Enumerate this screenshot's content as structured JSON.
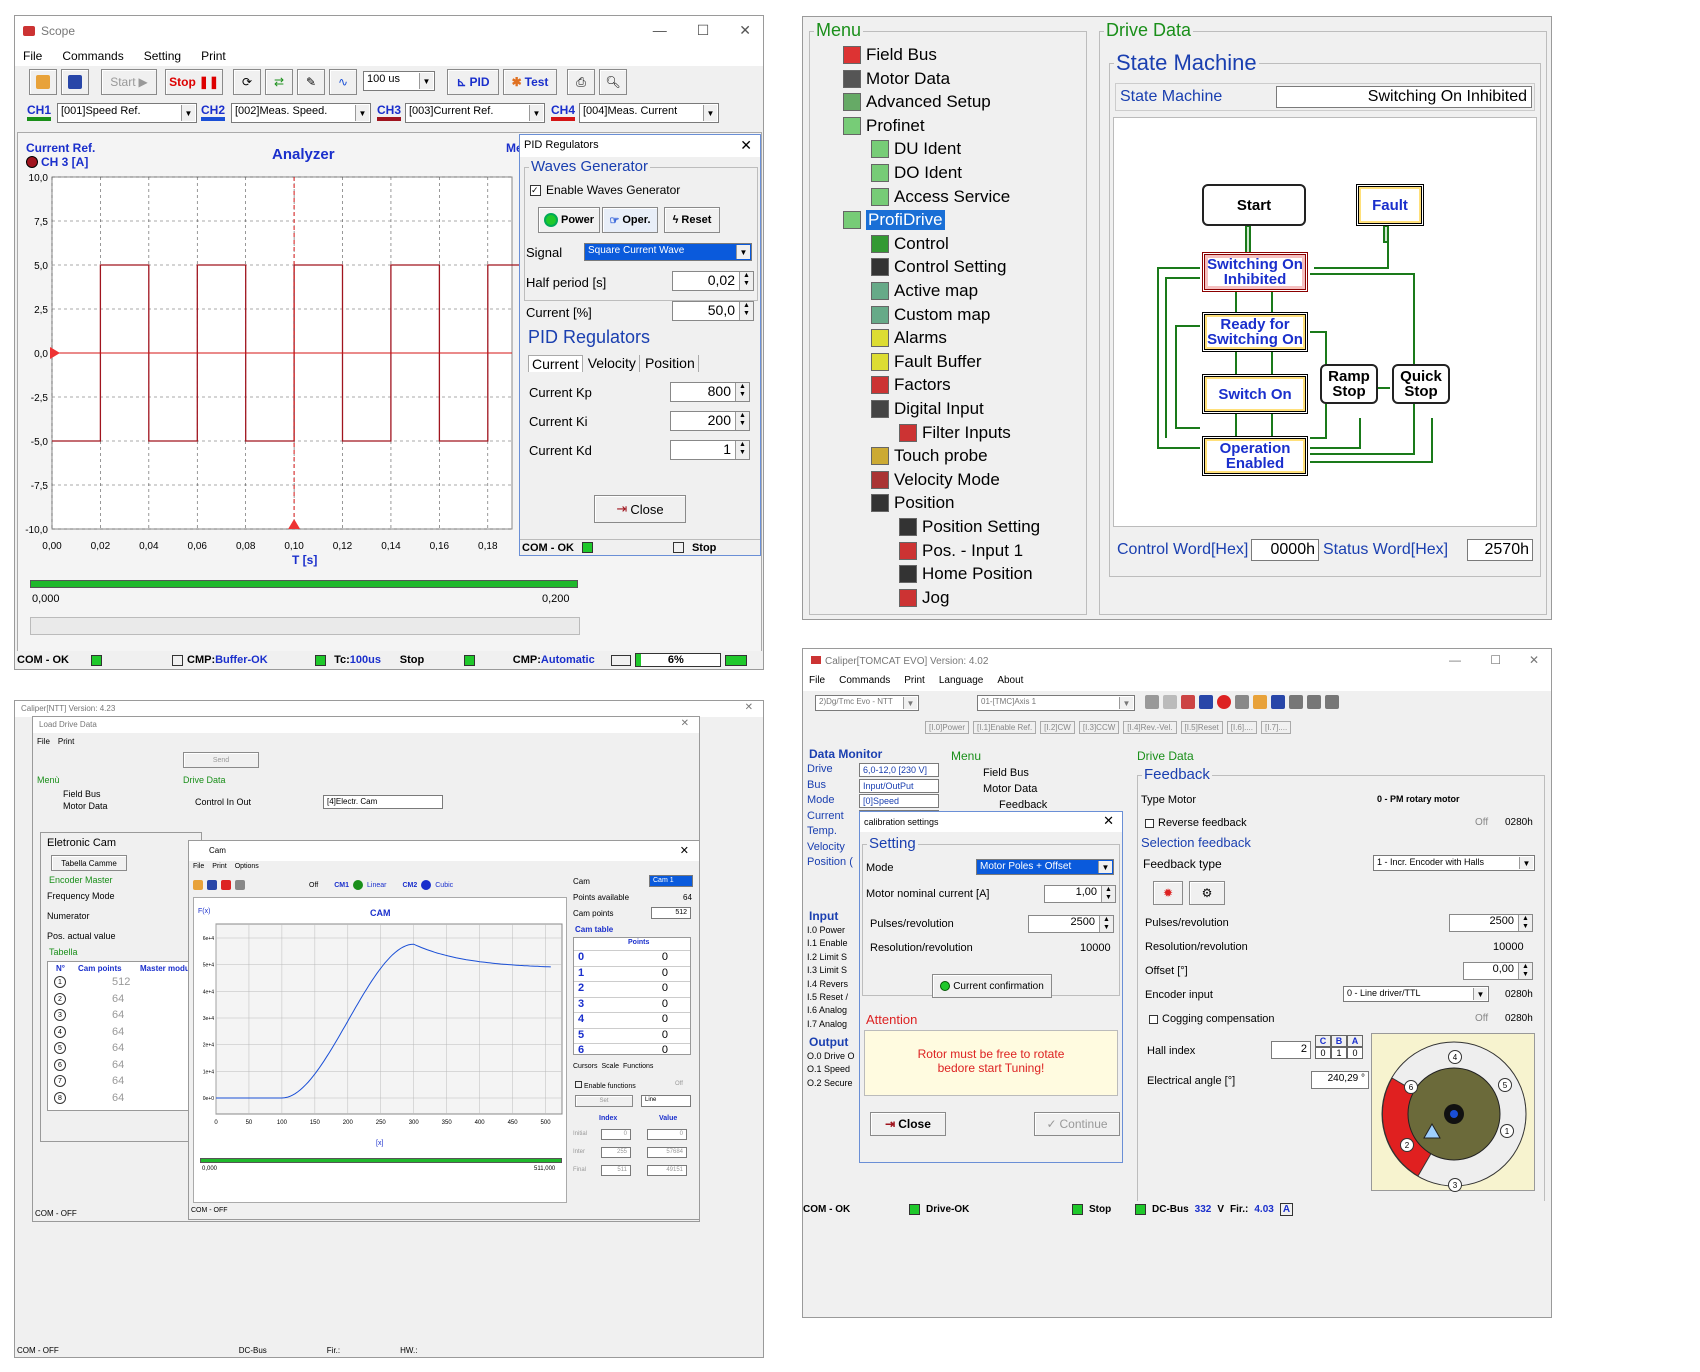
{
  "scope": {
    "title": "Scope",
    "menu": [
      "File",
      "Commands",
      "Setting",
      "Print"
    ],
    "toolbar": {
      "start": "Start",
      "stop": "Stop",
      "interval": "100 us",
      "pid": "PID",
      "test": "Test"
    },
    "channels": [
      {
        "label": "CH1",
        "value": "[001]Speed Ref.",
        "color": "#1a8f1a"
      },
      {
        "label": "CH2",
        "value": "[002]Meas. Speed.",
        "color": "#1a4fd6"
      },
      {
        "label": "CH3",
        "value": "[003]Current Ref.",
        "color": "#a0141e"
      },
      {
        "label": "CH4",
        "value": "[004]Meas. Current",
        "color": "#d41414"
      }
    ],
    "plot": {
      "title": "Analyzer",
      "channel_label": "Current Ref.",
      "channel_sub": "CH 3 [A]",
      "me": "Me",
      "xlabel": "T [s]",
      "range_start": "0,000",
      "range_end": "0,200"
    },
    "status": {
      "com": "COM - OK",
      "cmp": "CMP:",
      "buffer": "Buffer-OK",
      "tc": "Tc:",
      "tc_val": "100us",
      "stop": "Stop",
      "cmp_mode": "Automatic",
      "pct": "6%"
    }
  },
  "chart_data": {
    "type": "line",
    "title": "Analyzer",
    "xlabel": "T [s]",
    "ylabel": "CH 3 [A]",
    "xlim": [
      0,
      0.2
    ],
    "ylim": [
      -10,
      10
    ],
    "x_ticks": [
      "0,00",
      "0,02",
      "0,04",
      "0,06",
      "0,08",
      "0,10",
      "0,12",
      "0,14",
      "0,16",
      "0,18"
    ],
    "y_ticks": [
      "10,0",
      "7,5",
      "5,0",
      "2,5",
      "0,0",
      "-2,5",
      "-5,0",
      "-7,5",
      "-10,0"
    ],
    "series": [
      {
        "name": "Current Ref.",
        "color": "#a0141e",
        "x": [
          0,
          0.02,
          0.02,
          0.04,
          0.04,
          0.06,
          0.06,
          0.08,
          0.08,
          0.1,
          0.1,
          0.12,
          0.12,
          0.14,
          0.14,
          0.16,
          0.16,
          0.18,
          0.18,
          0.2
        ],
        "y": [
          -5,
          -5,
          5,
          5,
          -5,
          -5,
          5,
          5,
          -5,
          -5,
          5,
          5,
          -5,
          -5,
          5,
          5,
          -5,
          -5,
          5,
          5
        ]
      }
    ]
  },
  "pid": {
    "title": "PID Regulators",
    "waves_title": "Waves Generator",
    "enable": "Enable Waves Generator",
    "power": "Power",
    "oper": "Oper.",
    "reset": "Reset",
    "signal_label": "Signal",
    "signal_value": "Square Current Wave",
    "half_label": "Half period [s]",
    "half_value": "0,02",
    "current_label": "Current [%]",
    "current_value": "50,0",
    "pid_title": "PID Regulators",
    "tabs": [
      "Current",
      "Velocity",
      "Position"
    ],
    "kp_label": "Current Kp",
    "kp": "800",
    "ki_label": "Current Ki",
    "ki": "200",
    "kd_label": "Current Kd",
    "kd": "1",
    "close": "Close",
    "com": "COM - OK",
    "stop": "Stop"
  },
  "drive": {
    "menu_title": "Menu",
    "data_title": "Drive Data",
    "sm_group": "State Machine",
    "sm_label": "State Machine",
    "sm_value": "Switching On Inhibited",
    "tree": [
      "Field Bus",
      "Motor Data",
      "Advanced Setup",
      "Profinet",
      "DU Ident",
      "DO Ident",
      "Access Service",
      "ProfiDrive",
      "Control",
      "Control Setting",
      "Active map",
      "Custom map",
      "Alarms",
      "Fault Buffer",
      "Factors",
      "Digital Input",
      "Filter Inputs",
      "Touch probe",
      "Velocity Mode",
      "Position",
      "Position Setting",
      "Pos. - Input 1",
      "Home Position",
      "Jog"
    ],
    "states": {
      "start": "Start",
      "fault": "Fault",
      "inhibited": "Switching On Inhibited",
      "ready": "Ready for Switching On",
      "switch_on": "Switch On",
      "ramp": "Ramp Stop",
      "quick": "Quick Stop",
      "enabled": "Operation Enabled"
    },
    "cw_label": "Control Word[Hex]",
    "cw": "0000h",
    "sw_label": "Status Word[Hex]",
    "sw": "2570h"
  },
  "ntt": {
    "title": "Caliper[NTT] Version: 4.23",
    "load_title": "Load Drive Data",
    "menu": [
      "File",
      "Print"
    ],
    "send": "Send",
    "menu_lbl": "Menù",
    "tree": [
      "Field Bus",
      "Motor Data",
      "Advanced Setup"
    ],
    "drive_data": "Drive Data",
    "control": "Control In Out",
    "control_val": "[4]Electr. Cam",
    "ecam": "Eletronic Cam",
    "tab_camme": "Tabella Camme",
    "enc_master": "Encoder Master",
    "freq": "Frequency Mode",
    "num": "Numerator",
    "pos": "Pos. actual value",
    "tabella": "Tabella",
    "cols": [
      "N°",
      "Cam points",
      "Master modul"
    ],
    "rows": [
      "512",
      "64",
      "64",
      "64",
      "64",
      "64",
      "64",
      "64"
    ],
    "cam": {
      "title": "Cam",
      "menu": [
        "File",
        "Print",
        "Options"
      ],
      "off": "Off",
      "cm1": "CM1",
      "linear": "Linear",
      "cm2": "CM2",
      "cubic": "Cubic",
      "fx": "F(x)",
      "plot_title": "CAM",
      "xlabel": "[x]",
      "x_ticks": [
        "0",
        "50",
        "100",
        "150",
        "200",
        "250",
        "300",
        "350",
        "400",
        "450",
        "500"
      ],
      "y_ticks": [
        "6e+4",
        "5e+4",
        "4e+4",
        "3e+4",
        "2e+4",
        "1e+4",
        "0e+0"
      ],
      "range_start": "0,000",
      "range_end": "511,000",
      "cam_lbl": "Cam",
      "cam_val": "Cam 1",
      "pts_avail": "Points available",
      "pts_avail_v": "64",
      "cam_pts": "Cam points",
      "cam_pts_v": "512",
      "cam_table": "Cam table",
      "points": "Points",
      "tabs": [
        "Cursors",
        "Scale",
        "Functions"
      ],
      "enable_fn": "Enable functions",
      "fn_off": "Off",
      "set": "Set",
      "line": "Line",
      "index": "Index",
      "value": "Value",
      "initial": "Initial",
      "inter": "Inter",
      "final": "Final",
      "init_i": "0",
      "init_v": "0",
      "inter_i": "255",
      "inter_v": "57684",
      "final_i": "511",
      "final_v": "49151"
    },
    "status": [
      "COM - OFF",
      "COM - OFF",
      "DC-Bus",
      "Fir.:",
      "HW.:"
    ]
  },
  "tomcat": {
    "title": "Caliper[TOMCAT EVO] Version: 4.02",
    "menu": [
      "File",
      "Commands",
      "Print",
      "Language",
      "About"
    ],
    "drive_sel": "2)Dg/Tmc Evo - NTT",
    "axis": "01-[TMC]Axis 1",
    "chips": [
      "[I.0]Power",
      "[I.1]Enable Ref.",
      "[I.2]CW",
      "[I.3]CCW",
      "[I.4]Rev.-Vel.",
      "[I.5]Reset",
      "[I.6]....",
      "[I.7]...."
    ],
    "dm_title": "Data Monitor",
    "dm": [
      [
        "Drive",
        "6,0-12,0 [230 V]"
      ],
      [
        "Bus",
        "Input/OutPut"
      ],
      [
        "Mode",
        "[0]Speed"
      ],
      [
        "Current",
        ""
      ],
      [
        "Temp.",
        ""
      ],
      [
        "Velocity",
        ""
      ],
      [
        "Position (",
        ""
      ]
    ],
    "input_title": "Input",
    "inputs": [
      "I.0 Power",
      "I.1 Enable",
      "I.2 Limit S",
      "I.3 Limit S",
      "I.4 Revers",
      "I.5 Reset /",
      "I.6 Analog",
      "I.7 Analog"
    ],
    "output_title": "Output",
    "outputs": [
      "O.0 Drive O",
      "O.1 Speed",
      "O.2 Secure"
    ],
    "menu_title": "Menu",
    "tree": [
      "Field Bus",
      "Motor Data",
      "Feedback"
    ],
    "drive_data": "Drive Data",
    "fb_title": "Feedback",
    "type_motor": "Type Motor",
    "type_val": "0 - PM rotary motor",
    "rev_fb": "Reverse feedback",
    "off": "Off",
    "h280": "0280h",
    "sel_fb": "Selection feedback",
    "fb_type": "Feedback type",
    "fb_type_val": "1 - Incr. Encoder with Halls",
    "ppr": "Pulses/revolution",
    "ppr_v": "2500",
    "rpr": "Resolution/revolution",
    "rpr_v": "10000",
    "offset": "Offset [°]",
    "offset_v": "0,00",
    "enc_in": "Encoder input",
    "enc_in_v": "0 - Line driver/TTL",
    "cogging": "Cogging compensation",
    "hall": "Hall index",
    "hall_v": "2",
    "cba": [
      "C",
      "B",
      "A"
    ],
    "cba_v": [
      "0",
      "1",
      "0"
    ],
    "elec": "Electrical angle [°]",
    "elec_v": "240,29 °",
    "sectors": [
      "1",
      "2",
      "3",
      "4",
      "5",
      "6"
    ],
    "calib": {
      "title": "calibration settings",
      "setting": "Setting",
      "mode": "Mode",
      "mode_v": "Motor Poles + Offset",
      "mnc": "Motor nominal current [A]",
      "mnc_v": "1,00",
      "ppr": "Pulses/revolution",
      "ppr_v": "2500",
      "rpr": "Resolution/revolution",
      "rpr_v": "10000",
      "confirm": "Current confirmation",
      "attention": "Attention",
      "warn1": "Rotor must be free to rotate",
      "warn2": "bedore start Tuning!",
      "close": "Close",
      "continue": "Continue"
    },
    "status": {
      "com": "COM - OK",
      "drive": "Drive-OK",
      "stop": "Stop",
      "dc": "DC-Bus",
      "dc_v": "332",
      "v": "V",
      "fir": "Fir.:",
      "fir_v": "4.03",
      "a": "A"
    }
  }
}
